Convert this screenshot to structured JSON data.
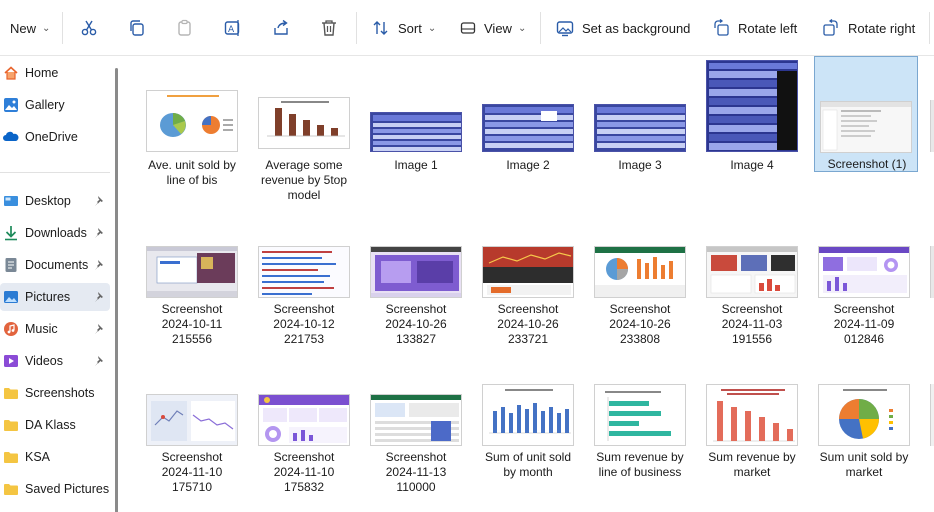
{
  "toolbar": {
    "new_label": "New",
    "sort_label": "Sort",
    "view_label": "View",
    "set_background_label": "Set as background",
    "rotate_left_label": "Rotate left",
    "rotate_right_label": "Rotate right"
  },
  "sidebar": {
    "items": [
      {
        "label": "Home",
        "icon": "home-icon"
      },
      {
        "label": "Gallery",
        "icon": "gallery-icon"
      },
      {
        "label": "OneDrive",
        "icon": "onedrive-icon"
      },
      {
        "label": "Desktop",
        "icon": "desktop-icon",
        "pinned": true
      },
      {
        "label": "Downloads",
        "icon": "downloads-icon",
        "pinned": true
      },
      {
        "label": "Documents",
        "icon": "documents-icon",
        "pinned": true
      },
      {
        "label": "Pictures",
        "icon": "pictures-icon",
        "pinned": true,
        "selected": true
      },
      {
        "label": "Music",
        "icon": "music-icon",
        "pinned": true
      },
      {
        "label": "Videos",
        "icon": "videos-icon",
        "pinned": true
      },
      {
        "label": "Screenshots",
        "icon": "folder-icon"
      },
      {
        "label": "DA Klass",
        "icon": "folder-icon"
      },
      {
        "label": "KSA",
        "icon": "folder-icon"
      },
      {
        "label": "Saved Pictures",
        "icon": "folder-icon"
      }
    ]
  },
  "files": {
    "row1": [
      {
        "lines": [
          "Ave. unit sold by",
          "line of bis"
        ],
        "thumb": "pie-chart"
      },
      {
        "lines": [
          "Average some",
          "revenue by 5top",
          "model"
        ],
        "thumb": "bar-chart"
      },
      {
        "lines": [
          "Image 1"
        ],
        "thumb": "table-blue"
      },
      {
        "lines": [
          "Image 2"
        ],
        "thumb": "table-blue"
      },
      {
        "lines": [
          "Image 3"
        ],
        "thumb": "table-blue"
      },
      {
        "lines": [
          "Image 4"
        ],
        "thumb": "table-tall"
      },
      {
        "lines": [
          "Screenshot (1)"
        ],
        "thumb": "screenshot",
        "selected": true
      }
    ],
    "row2": [
      {
        "lines": [
          "Screenshot",
          "2024-10-11",
          "215556"
        ],
        "thumb": "screen-dialog"
      },
      {
        "lines": [
          "Screenshot",
          "2024-10-12",
          "221753"
        ],
        "thumb": "screen-code"
      },
      {
        "lines": [
          "Screenshot",
          "2024-10-26",
          "133827"
        ],
        "thumb": "screen-purple"
      },
      {
        "lines": [
          "Screenshot",
          "2024-10-26",
          "233721"
        ],
        "thumb": "screen-red"
      },
      {
        "lines": [
          "Screenshot",
          "2024-10-26",
          "233808"
        ],
        "thumb": "screen-excel"
      },
      {
        "lines": [
          "Screenshot",
          "2024-11-03",
          "191556"
        ],
        "thumb": "screen-dash"
      },
      {
        "lines": [
          "Screenshot",
          "2024-11-09",
          "012846"
        ],
        "thumb": "screen-dash2"
      }
    ],
    "row3": [
      {
        "lines": [
          "Screenshot",
          "2024-11-10",
          "175710"
        ],
        "thumb": "screen-map"
      },
      {
        "lines": [
          "Screenshot",
          "2024-11-10",
          "175832"
        ],
        "thumb": "screen-purple2"
      },
      {
        "lines": [
          "Screenshot",
          "2024-11-13",
          "110000"
        ],
        "thumb": "screen-excel2"
      },
      {
        "lines": [
          "Sum of unit sold",
          "by month"
        ],
        "thumb": "chart-bars-blue"
      },
      {
        "lines": [
          "Sum revenue by",
          "line of business"
        ],
        "thumb": "chart-hbars"
      },
      {
        "lines": [
          "Sum revenue by",
          "market"
        ],
        "thumb": "chart-bars-red"
      },
      {
        "lines": [
          "Sum unit sold by",
          "market"
        ],
        "thumb": "chart-pie"
      }
    ]
  },
  "colors": {
    "accent": "#0067c0",
    "selected_tile": "#cce4f7",
    "selected_nav": "#e5eaf2",
    "folder": "#f4c542"
  }
}
